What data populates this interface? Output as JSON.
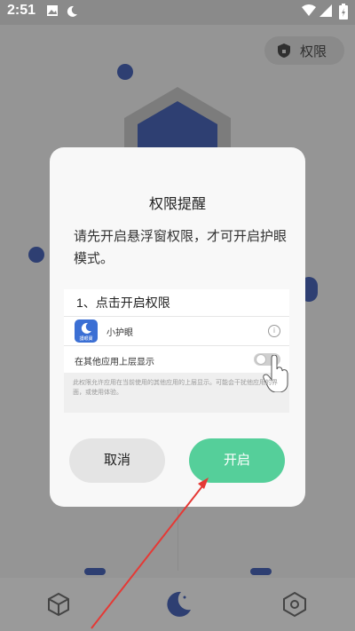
{
  "status_bar": {
    "time": "2:51"
  },
  "background": {
    "permission_chip_label": "权限"
  },
  "dialog": {
    "title": "权限提醒",
    "message": "请先开启悬浮窗权限，才可开启护眼模式。",
    "demo": {
      "step_label": "1、点击开启权限",
      "app_name": "小护眼",
      "app_icon_caption": "護眼寶",
      "toggle_label": "在其他应用上层显示",
      "description": "此权限允许应用在当前使用的其他应用的上层显示。可能会干扰他应用的界面，或使用体验。"
    },
    "cancel_label": "取消",
    "confirm_label": "开启"
  },
  "colors": {
    "accent": "#55cf9a",
    "brand_blue": "#2e3f72",
    "arrow": "#e53935"
  }
}
